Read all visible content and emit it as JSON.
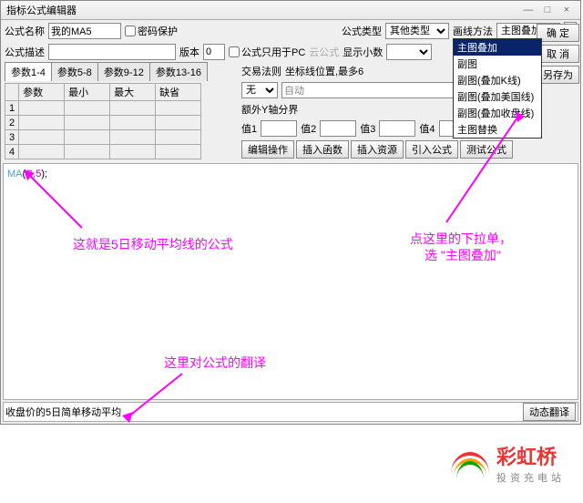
{
  "title": "指标公式编辑器",
  "labels": {
    "name": "公式名称",
    "desc": "公式描述",
    "pwd": "密码保护",
    "type": "公式类型",
    "draw": "画线方法",
    "ver": "版本",
    "pconly": "公式只用于PC",
    "cloud": "云公式",
    "dec": "显示小数",
    "rule": "交易法则",
    "coord": "坐标线位置,最多6",
    "extra": "额外Y轴分界",
    "v1": "值1",
    "v2": "值2",
    "v3": "值3",
    "v4": "值4"
  },
  "name_val": "我的MA5",
  "type_val": "其他类型",
  "draw_val": "主图叠加",
  "rule_val": "无",
  "auto": "自动",
  "tabs": [
    "参数1-4",
    "参数5-8",
    "参数9-12",
    "参数13-16"
  ],
  "pheaders": [
    "参数",
    "最小",
    "最大",
    "缺省"
  ],
  "prows": [
    "1",
    "2",
    "3",
    "4"
  ],
  "dropdown": [
    "主图叠加",
    "副图",
    "副图(叠加K线)",
    "副图(叠加美国线)",
    "副图(叠加收盘线)",
    "主图替换"
  ],
  "btns": {
    "ok": "确 定",
    "cancel": "取 消",
    "saveas": "另存为",
    "edit": "编辑操作",
    "insfn": "插入函数",
    "insres": "插入资源",
    "import": "引入公式",
    "test": "测试公式",
    "trans": "动态翻译"
  },
  "code": {
    "fn": "MA",
    "a1": "C",
    "a2": "5"
  },
  "bottom": "收盘价的5日简单移动平均",
  "annot": {
    "a1": "这就是5日移动平均线的公式",
    "a2": "这里对公式的翻译",
    "a3": "点这里的下拉单，",
    "a4": "选 \"主图叠加\""
  },
  "logo": {
    "t1": "彩虹桥",
    "t2": "投资充电站"
  }
}
